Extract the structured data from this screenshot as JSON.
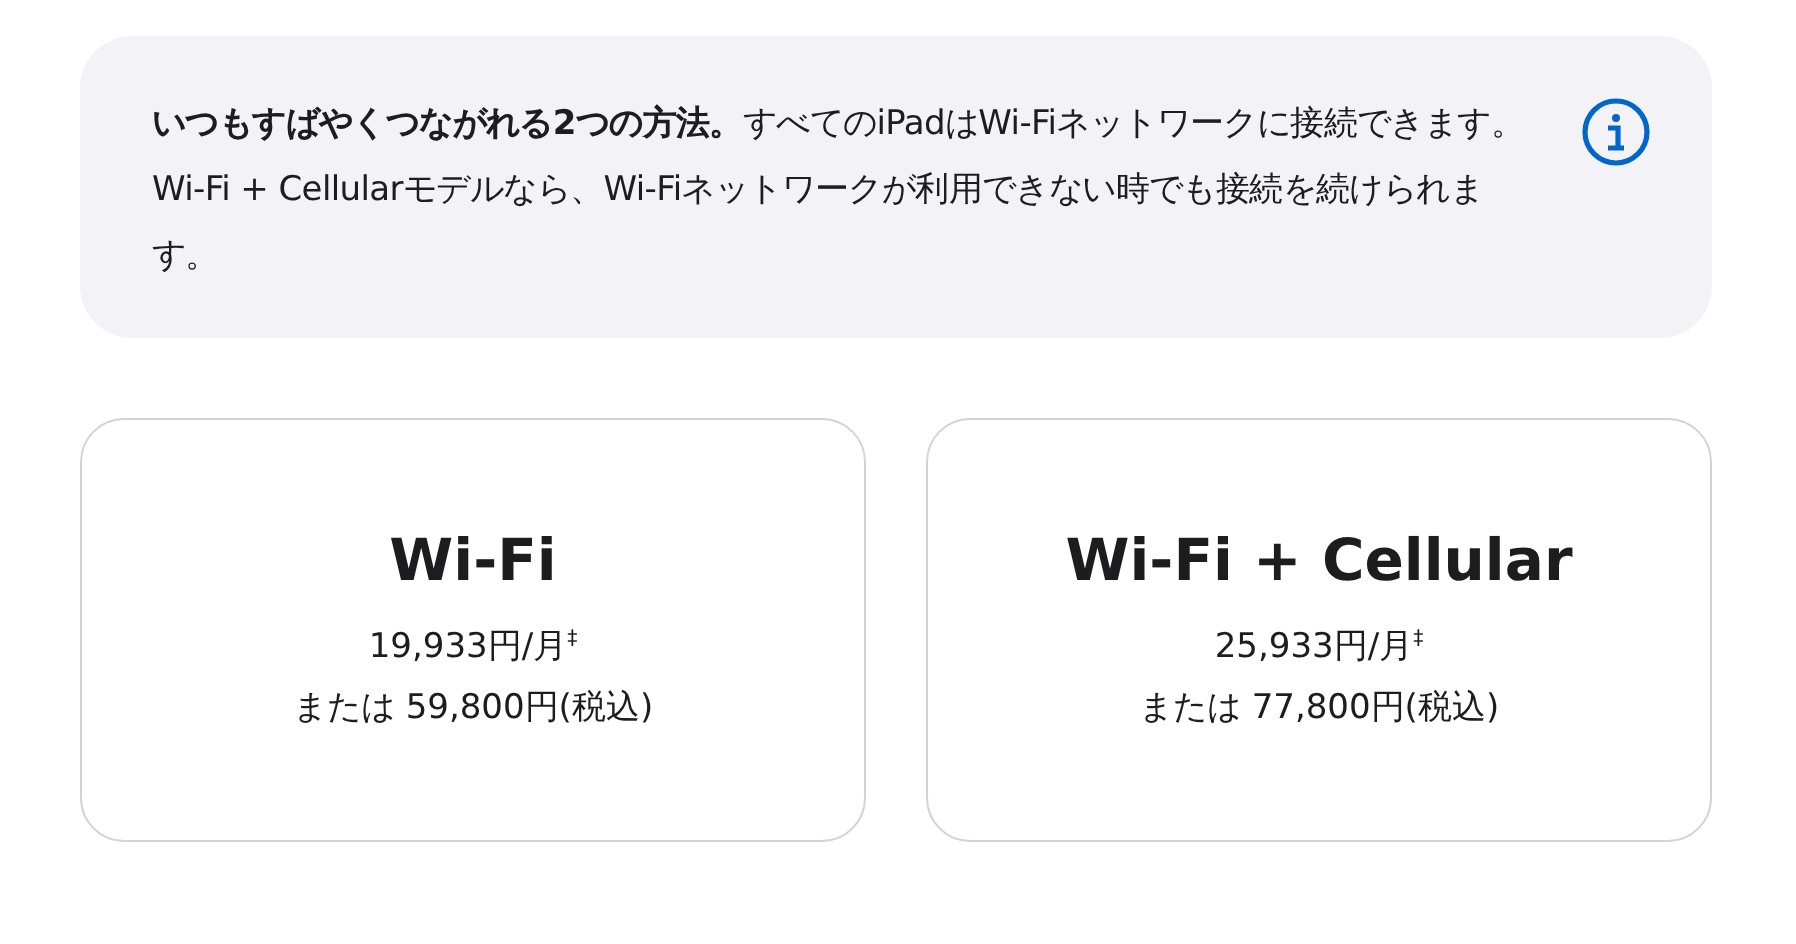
{
  "notice": {
    "text": "**いつもすばやくつながれる2つの方法。**すべてのiPadはWi-Fiネットワークに接続できます。Wi-Fi + Cellularモデルなら、Wi-Fiネットワークが利用できない時でも接続を続けられます。"
  },
  "options": [
    {
      "title": "Wi-Fi",
      "monthly": "19,933円/月$^{‡}$",
      "total": "または 59,800円(税込)",
      "selected": false
    },
    {
      "title": "Wi-Fi + Cellular",
      "monthly": "25,933円/月$^{‡}$",
      "total": "または 77,800円(税込)",
      "selected": false
    }
  ]
}
